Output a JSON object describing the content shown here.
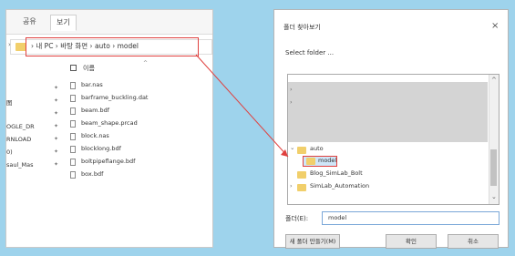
{
  "explorer": {
    "ribbon_tabs": [
      "공유",
      "보기"
    ],
    "breadcrumb": "› 내 PC › 바탕 화면 › auto › model",
    "nav_items": [
      "",
      "",
      "图",
      "",
      "OGLE_DR",
      "RNLOAD",
      "0)",
      "saul_Mas"
    ],
    "column_header": "이름",
    "files": [
      "bar.nas",
      "barframe_buckling.dat",
      "beam.bdf",
      "beam_shape.prcad",
      "block.nas",
      "blocklong.bdf",
      "boltpipeflange.bdf",
      "box.bdf"
    ]
  },
  "dialog": {
    "title": "폴더 찾아보기",
    "close_glyph": "×",
    "prompt": "Select folder ...",
    "tree_items": [
      "auto",
      "model",
      "Blog_SimLab_Bolt",
      "SimLab_Automation"
    ],
    "folder_label": "폴더(E):",
    "folder_value": "model",
    "new_folder_button": "새 폴더 만들기(M)",
    "ok_button": "확인",
    "cancel_button": "취소"
  },
  "colors": {
    "highlight": "#e0413f",
    "background": "#9ed3ec",
    "folder": "#f1cf6b"
  }
}
